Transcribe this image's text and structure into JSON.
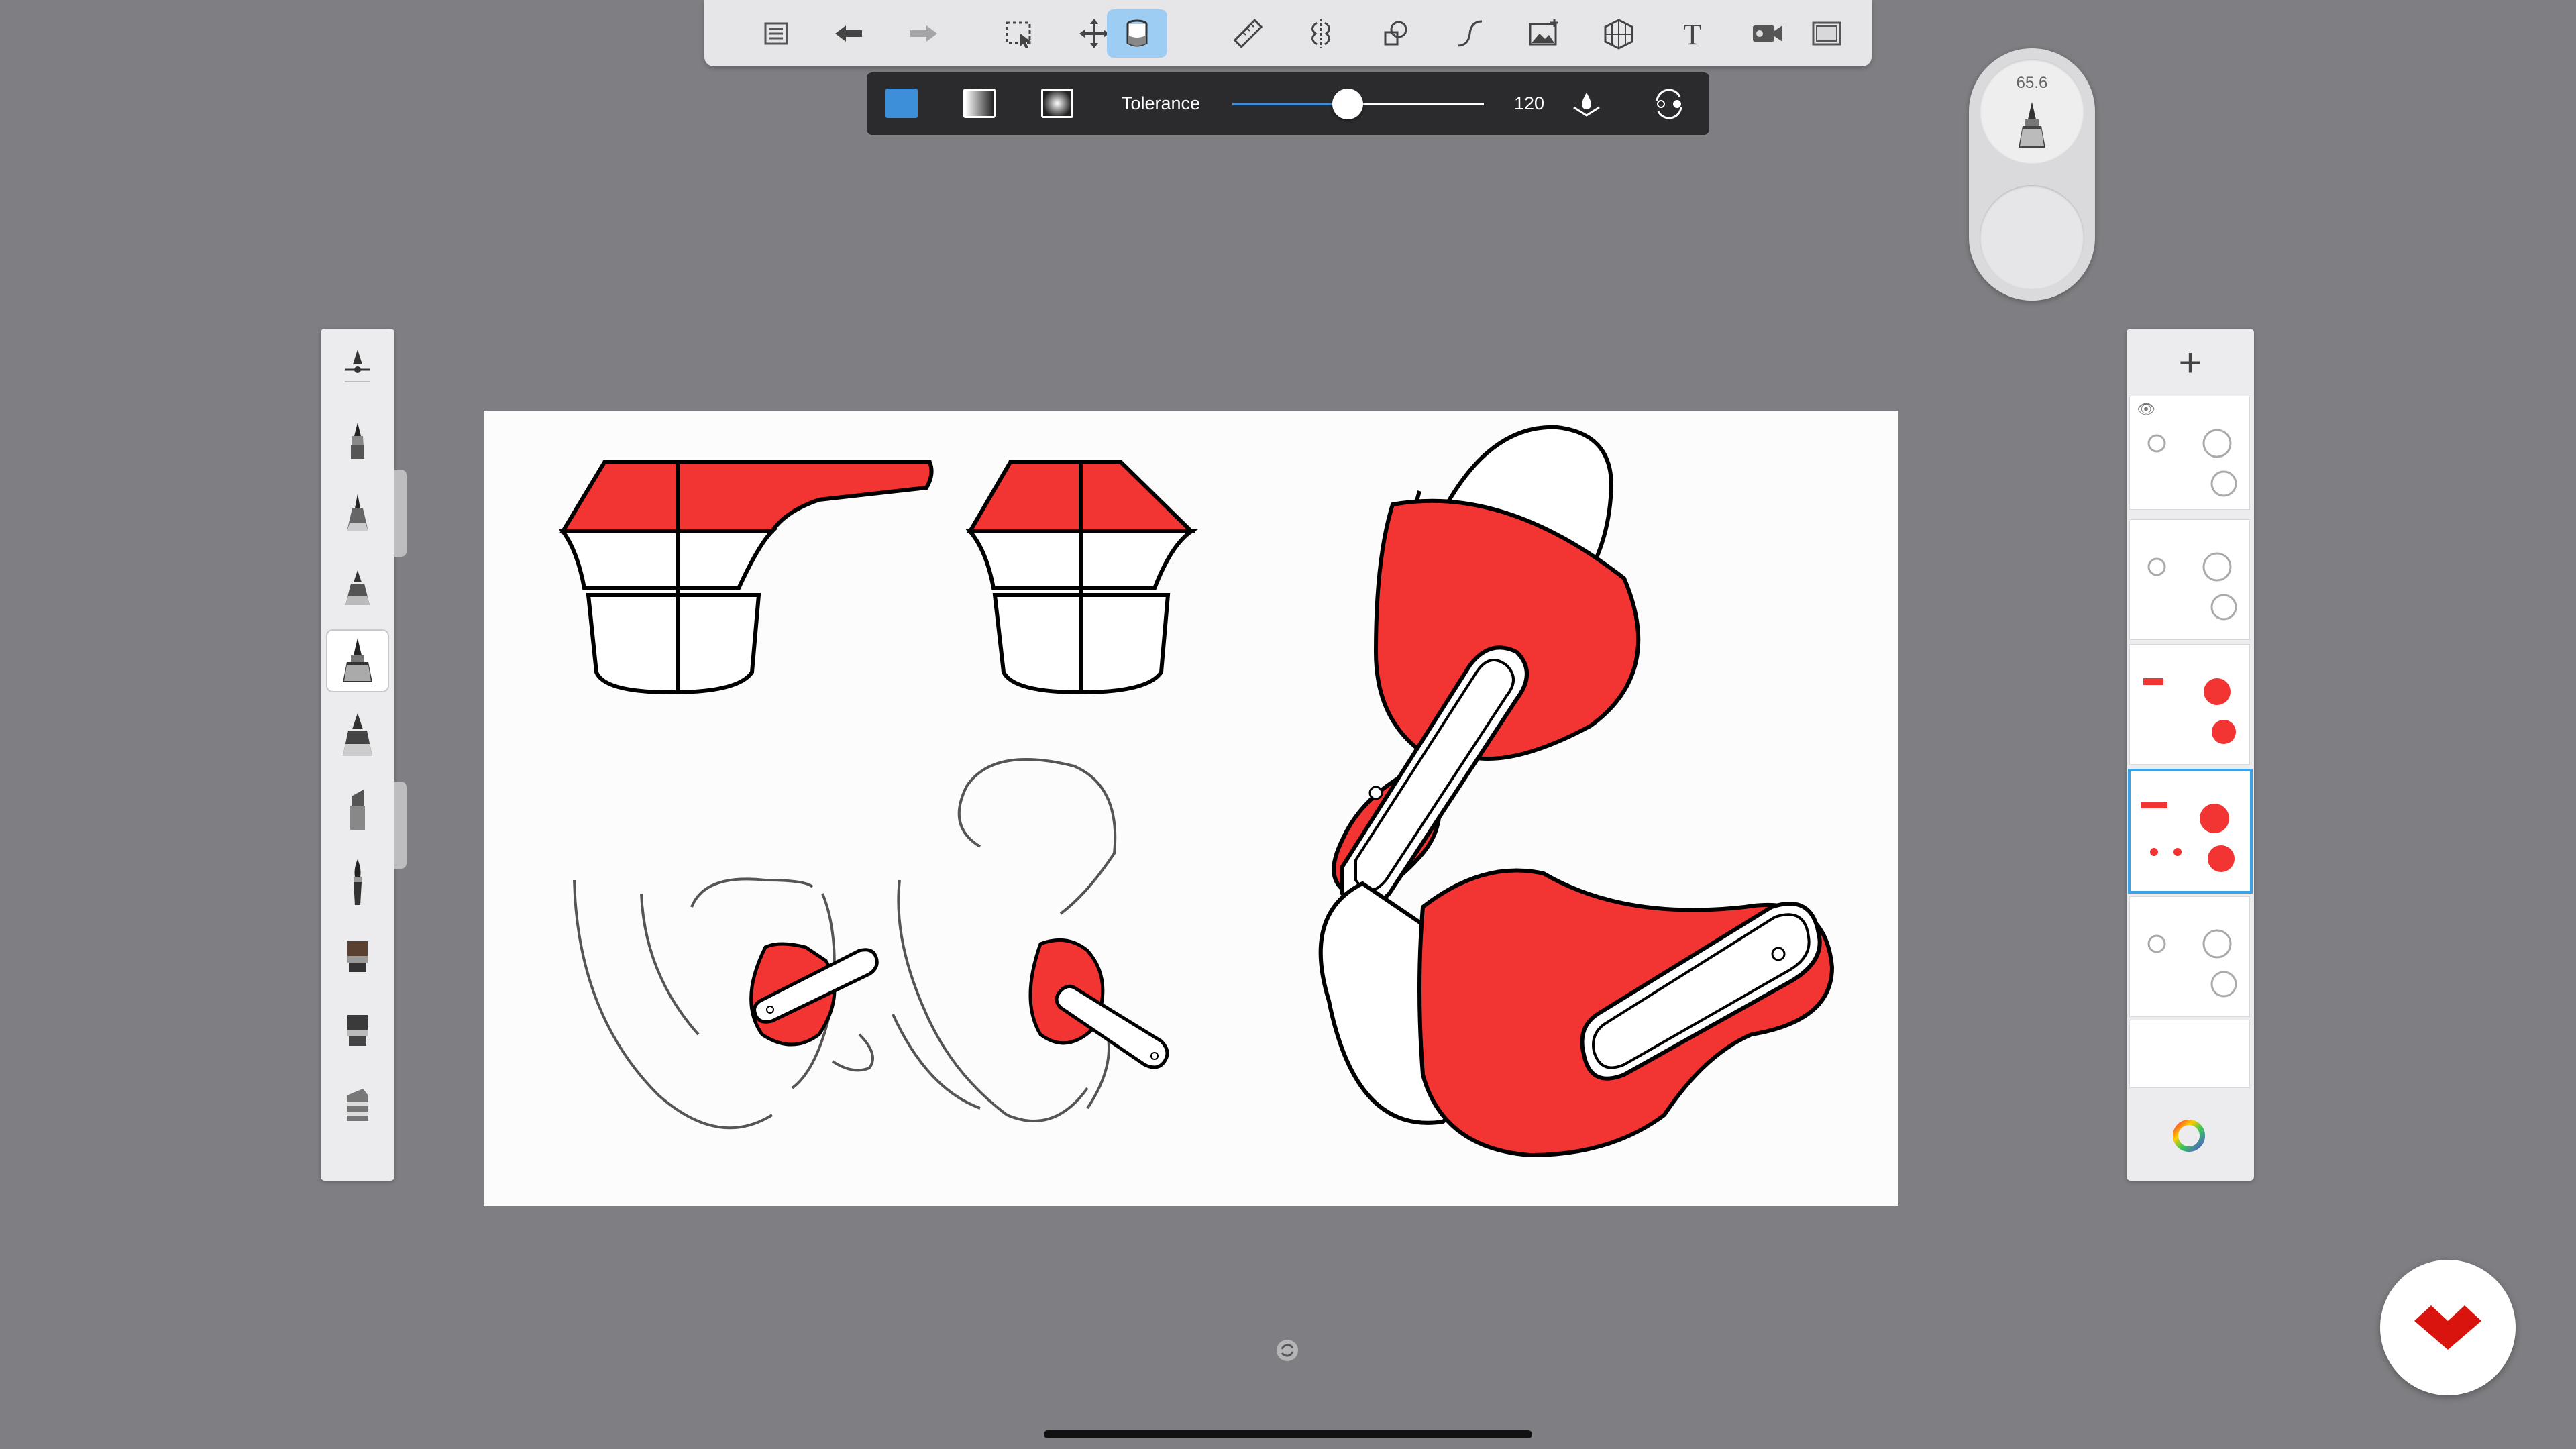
{
  "toolbar": {
    "items": [
      {
        "name": "layer-list-icon"
      },
      {
        "name": "undo-icon"
      },
      {
        "name": "redo-icon"
      },
      {
        "name": "select-icon"
      },
      {
        "name": "transform-icon"
      },
      {
        "name": "fill-icon",
        "active": true
      },
      {
        "name": "ruler-icon"
      },
      {
        "name": "symmetry-icon"
      },
      {
        "name": "shapes-icon"
      },
      {
        "name": "curve-icon"
      },
      {
        "name": "image-icon"
      },
      {
        "name": "perspective-icon"
      },
      {
        "name": "text-icon",
        "glyph": "T"
      },
      {
        "name": "record-icon"
      },
      {
        "name": "fullscreen-icon"
      }
    ]
  },
  "fill_bar": {
    "tolerance_label": "Tolerance",
    "tolerance_value": "120",
    "tolerance_fraction": 0.47,
    "fill_color": "#3d8fd9"
  },
  "puck": {
    "brush_size": "65.6"
  },
  "brush_palette": {
    "selected_index": 4
  },
  "layers": {
    "add_label": "+",
    "selected_index": 3,
    "count": 6
  },
  "colors": {
    "accent_red": "#f23433",
    "accent_blue": "#3aa3e8",
    "background": "#7f7e82"
  }
}
